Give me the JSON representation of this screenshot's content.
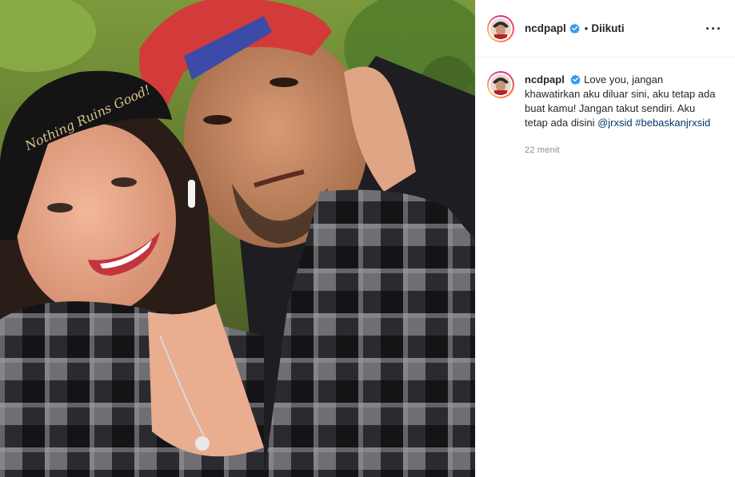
{
  "post": {
    "username": "ncdpapl",
    "follow_status": "Diikuti",
    "caption_text": "Love you, jangan khawatirkan aku diluar sini, aku tetap ada buat kamu! Jangan takut sendiri. Aku tetap ada disini",
    "mention": "@jrxsid",
    "hashtag": "#bebaskanjrxsid",
    "time_ago": "22 menit",
    "cap_embroidery": "Nothing Ruins Good!"
  },
  "colors": {
    "verified_badge": "#3897f0",
    "link": "#00376b",
    "border": "#efefef"
  },
  "icons": {
    "verified": "verified-badge-icon",
    "more": "more-options-icon"
  }
}
